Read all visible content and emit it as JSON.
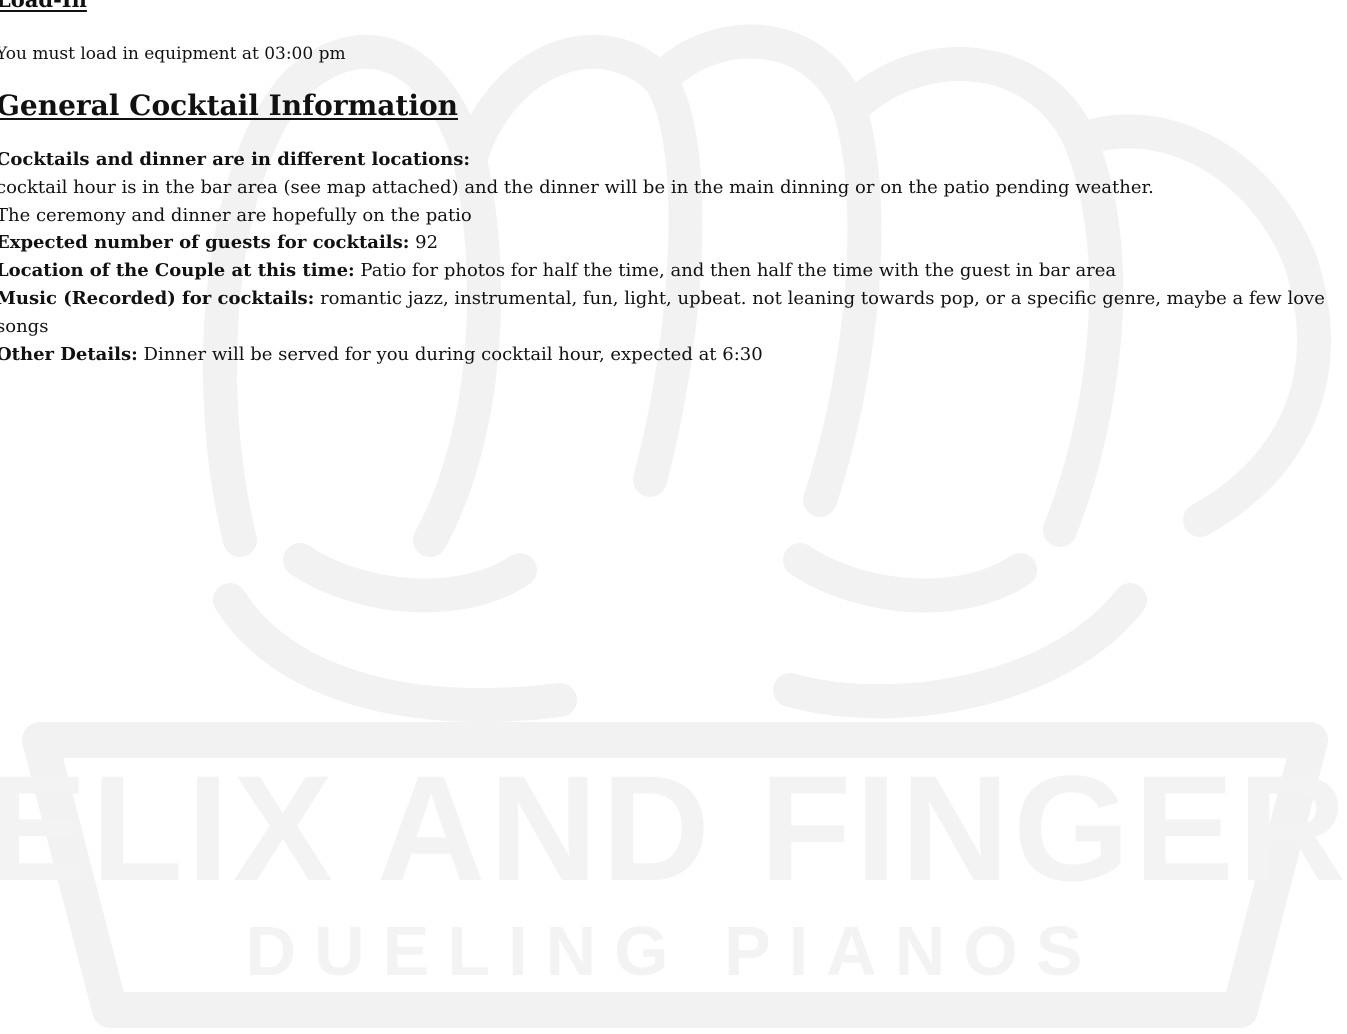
{
  "load_in": {
    "heading": "Load-In",
    "text": "You must load in equipment at 03:00 pm"
  },
  "cocktail": {
    "heading": "General Cocktail Information",
    "locations_label": "Cocktails and dinner are in different locations:",
    "locations_text": "cocktail hour is in the bar area (see map attached) and the dinner will be in the main dinning or on the patio pending weather.",
    "ceremony_text": "The ceremony and dinner are hopefully on the patio",
    "guests_label": "Expected number of guests for cocktails:",
    "guests_value": "92",
    "couple_label": "Location of the Couple at this time:",
    "couple_value": "Patio for photos for half the time, and then half the time with the guest in bar area",
    "music_label": "Music (Recorded) for cocktails:",
    "music_value": "romantic jazz, instrumental, fun, light, upbeat. not leaning towards pop, or a specific genre, maybe a few love songs",
    "other_label": "Other Details:",
    "other_value": "Dinner will be served for you during cocktail hour, expected at 6:30"
  },
  "watermark": {
    "line1": "FELIX AND FINGERS",
    "line2": "DUELING PIANOS",
    "icon": "fist-logo-icon",
    "color": "#f3f3f3"
  }
}
